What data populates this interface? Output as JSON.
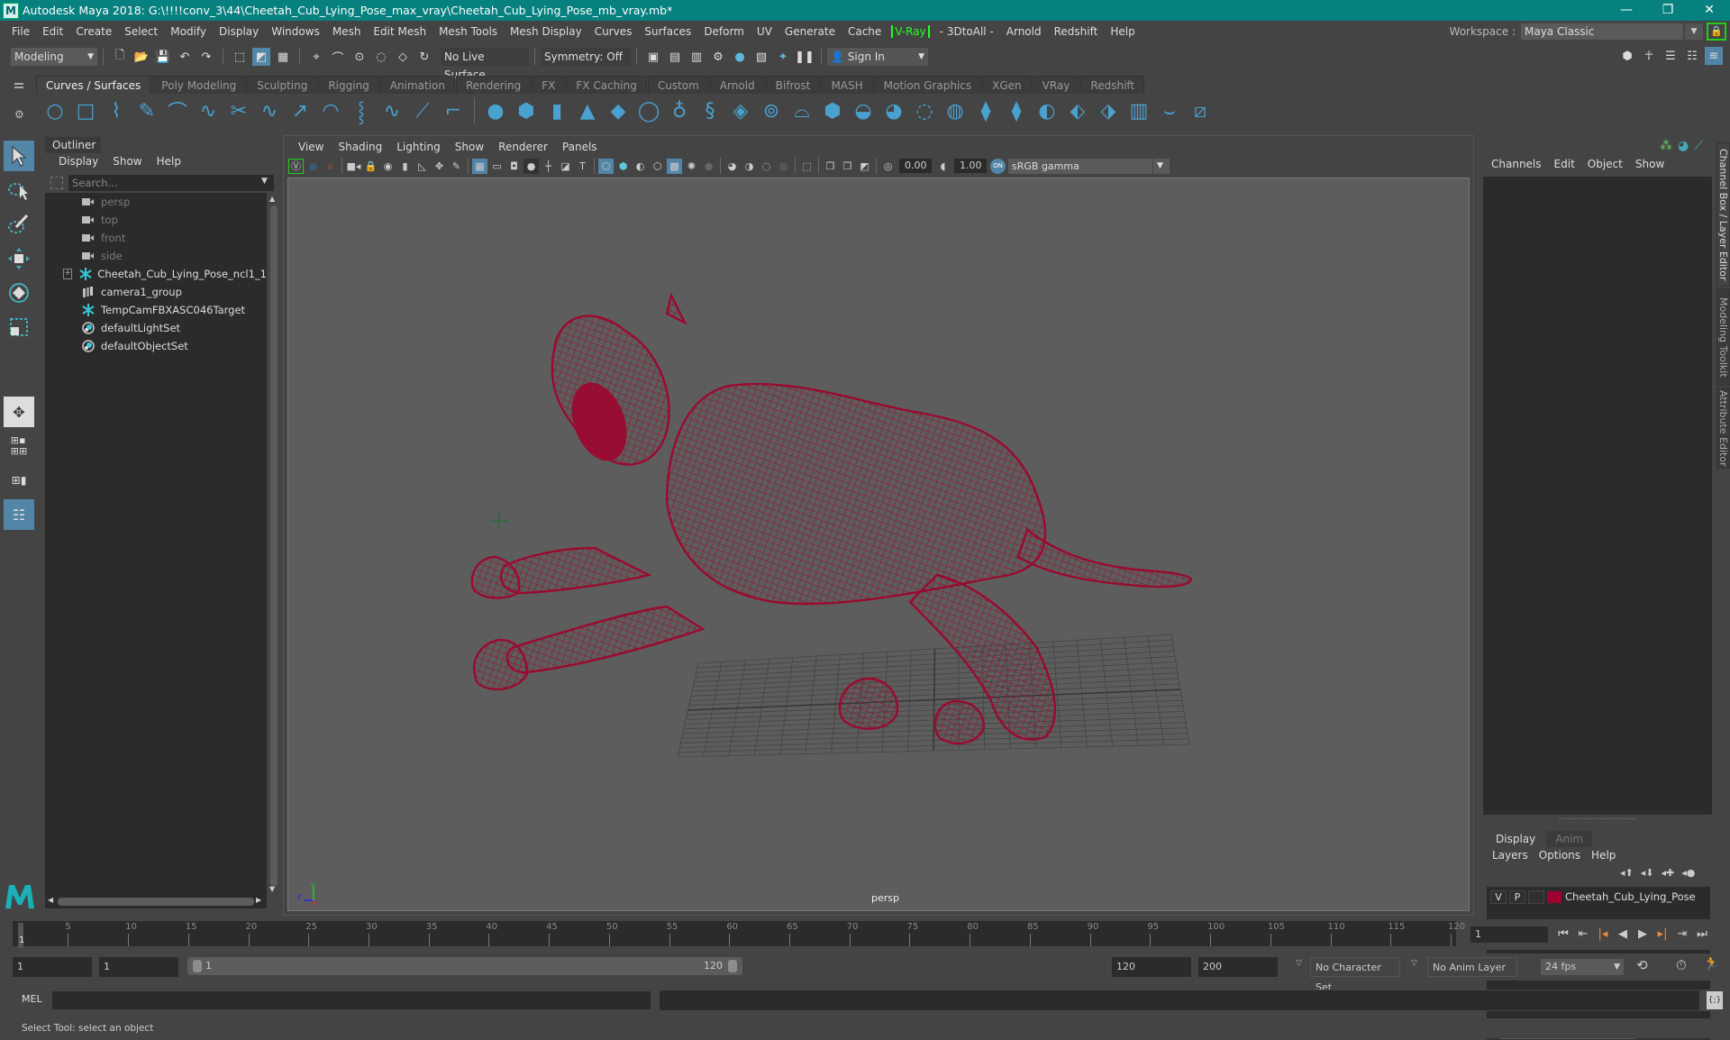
{
  "window": {
    "title": "Autodesk Maya 2018: G:\\!!!!conv_3\\44\\Cheetah_Cub_Lying_Pose_max_vray\\Cheetah_Cub_Lying_Pose_mb_vray.mb*",
    "minimize": "—",
    "maximize": "❐",
    "close": "✕"
  },
  "menubar": {
    "items": [
      "File",
      "Edit",
      "Create",
      "Select",
      "Modify",
      "Display",
      "Windows",
      "Mesh",
      "Edit Mesh",
      "Mesh Tools",
      "Mesh Display",
      "Curves",
      "Surfaces",
      "Deform",
      "UV",
      "Generate",
      "Cache"
    ],
    "vray": "V-Ray",
    "items2": [
      "- 3DtoAll -",
      "Arnold",
      "Redshift",
      "Help"
    ]
  },
  "workspace": {
    "label": "Workspace :",
    "value": "Maya Classic"
  },
  "statusline": {
    "mode": "Modeling",
    "live_surface": "No Live Surface",
    "symmetry": "Symmetry: Off",
    "sign_in": "Sign In"
  },
  "shelf": {
    "tabs": [
      "Curves / Surfaces",
      "Poly Modeling",
      "Sculpting",
      "Rigging",
      "Animation",
      "Rendering",
      "FX",
      "FX Caching",
      "Custom",
      "Arnold",
      "Bifrost",
      "MASH",
      "Motion Graphics",
      "XGen",
      "VRay",
      "Redshift"
    ],
    "active_tab": "Curves / Surfaces"
  },
  "outliner": {
    "title": "Outliner",
    "menu": [
      "Display",
      "Show",
      "Help"
    ],
    "search_placeholder": "Search...",
    "items": [
      {
        "label": "persp",
        "icon": "camera-icon",
        "dim": true
      },
      {
        "label": "top",
        "icon": "camera-icon",
        "dim": true
      },
      {
        "label": "front",
        "icon": "camera-icon",
        "dim": true
      },
      {
        "label": "side",
        "icon": "camera-icon",
        "dim": true
      },
      {
        "label": "Cheetah_Cub_Lying_Pose_ncl1_1",
        "icon": "transform-star-icon",
        "expandable": true
      },
      {
        "label": "camera1_group",
        "icon": "group-icon"
      },
      {
        "label": "TempCamFBXASC046Target",
        "icon": "transform-star-icon"
      },
      {
        "label": "defaultLightSet",
        "icon": "set-icon"
      },
      {
        "label": "defaultObjectSet",
        "icon": "set-icon"
      }
    ]
  },
  "viewport": {
    "menu": [
      "View",
      "Shading",
      "Lighting",
      "Show",
      "Renderer",
      "Panels"
    ],
    "exposure": "0.00",
    "gamma": "1.00",
    "color_space": "sRGB gamma",
    "camera_label": "persp",
    "axis": {
      "x": "x",
      "y": "y",
      "z": "z"
    },
    "wire_color": "#9a0a30"
  },
  "channelbox": {
    "menu": [
      "Channels",
      "Edit",
      "Object",
      "Show"
    ],
    "side_tabs": [
      "Channel Box / Layer Editor",
      "Modeling Toolkit",
      "Attribute Editor"
    ]
  },
  "layers": {
    "tabs": [
      "Display",
      "Anim"
    ],
    "active_tab": "Display",
    "menu": [
      "Layers",
      "Options",
      "Help"
    ],
    "rows": [
      {
        "v": "V",
        "p": "P",
        "color": "#a00030",
        "name": "Cheetah_Cub_Lying_Pose"
      }
    ]
  },
  "timeslider": {
    "ticks": [
      5,
      10,
      15,
      20,
      25,
      30,
      35,
      40,
      45,
      50,
      55,
      60,
      65,
      70,
      75,
      80,
      85,
      90,
      95,
      100,
      105,
      110,
      115,
      120
    ],
    "current": "1",
    "current_frame_field": "1"
  },
  "range": {
    "start": "1",
    "anim_start": "1",
    "range_start": "1",
    "range_end": "120",
    "anim_end_field": "120",
    "end": "200",
    "character_set": "No Character Set",
    "anim_layer": "No Anim Layer",
    "fps": "24 fps"
  },
  "cmdline": {
    "label": "MEL"
  },
  "status": {
    "text": "Select Tool: select an object"
  }
}
